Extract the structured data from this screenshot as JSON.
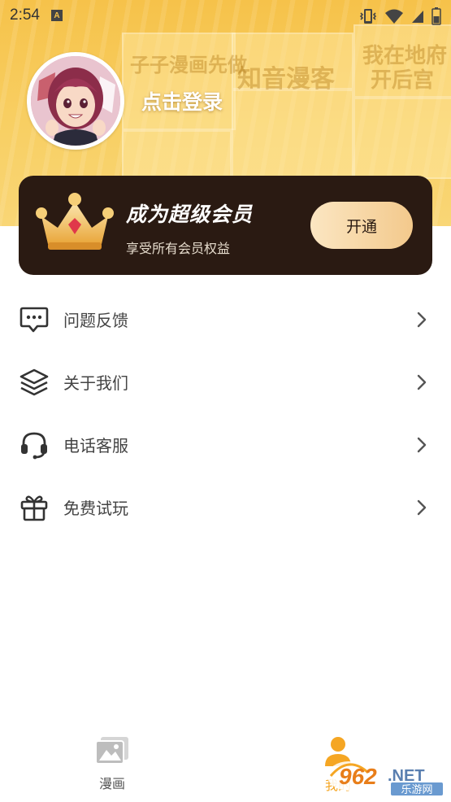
{
  "status_bar": {
    "time": "2:54",
    "notification_icon": "A"
  },
  "profile": {
    "login_label": "点击登录"
  },
  "banner_panels": [
    "子子漫画先做",
    "知音漫客",
    "我在地府",
    "开后宫"
  ],
  "vip": {
    "title": "成为超级会员",
    "subtitle": "享受所有会员权益",
    "button_label": "开通"
  },
  "menu": {
    "items": [
      {
        "label": "问题反馈",
        "icon": "feedback-icon"
      },
      {
        "label": "关于我们",
        "icon": "layers-icon"
      },
      {
        "label": "电话客服",
        "icon": "headset-icon"
      },
      {
        "label": "免费试玩",
        "icon": "gift-icon"
      }
    ]
  },
  "bottom_nav": {
    "items": [
      {
        "label": "漫画",
        "icon": "image-icon",
        "active": false
      },
      {
        "label": "我的",
        "icon": "person-icon",
        "active": true
      }
    ],
    "active_color": "#f5a623"
  },
  "watermark": {
    "number": "962",
    "suffix": ".NET",
    "caption": "乐游网"
  }
}
